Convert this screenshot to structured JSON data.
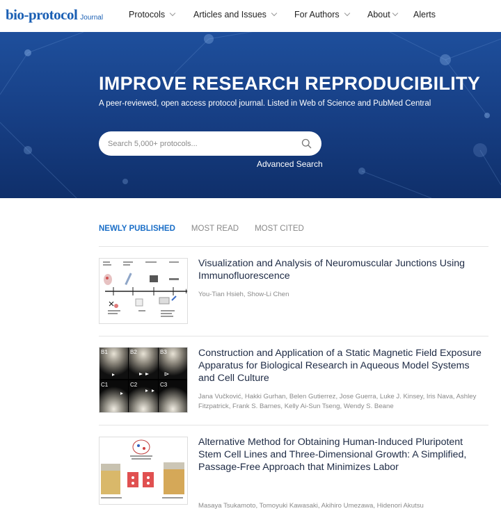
{
  "logo": {
    "main": "bio-protocol",
    "sub": "Journal"
  },
  "nav": [
    {
      "label": "Protocols",
      "dropdown": true
    },
    {
      "label": "Articles and Issues",
      "dropdown": true
    },
    {
      "label": "For Authors",
      "dropdown": true
    },
    {
      "label": "About",
      "dropdown": true
    },
    {
      "label": "Alerts",
      "dropdown": false
    }
  ],
  "hero": {
    "title": "IMPROVE RESEARCH REPRODUCIBILITY",
    "subtitle": "A peer-reviewed, open access protocol journal. Listed in Web of Science and PubMed Central",
    "search_placeholder": "Search 5,000+ protocols...",
    "advanced_search": "Advanced Search"
  },
  "tabs": [
    {
      "label": "NEWLY PUBLISHED",
      "active": true
    },
    {
      "label": "MOST READ",
      "active": false
    },
    {
      "label": "MOST CITED",
      "active": false
    }
  ],
  "articles": [
    {
      "title": "Visualization and Analysis of Neuromuscular Junctions Using Immunofluorescence",
      "authors": "You-Tian Hsieh, Show-Li Chen"
    },
    {
      "title": "Construction and Application of a Static Magnetic Field Exposure Apparatus for Biological Research in Aqueous Model Systems and Cell Culture",
      "authors": "Jana Vučković, Hakki Gurhan, Belen Gutierrez, Jose Guerra, Luke J. Kinsey, Iris Nava, Ashley Fitzpatrick, Frank S. Barnes, Kelly Ai-Sun Tseng, Wendy S. Beane",
      "thumb_labels": [
        "B1",
        "B2",
        "B3",
        "C1",
        "C2",
        "C3"
      ]
    },
    {
      "title": "Alternative Method for Obtaining Human-Induced Pluripotent Stem Cell Lines and Three-Dimensional Growth: A Simplified, Passage-Free Approach that Minimizes Labor",
      "authors": "Masaya Tsukamoto, Tomoyuki Kawasaki, Akihiro Umezawa, Hidenori Akutsu"
    }
  ],
  "colors": {
    "brand": "#1a5fb4",
    "hero": "#173f85",
    "active_tab": "#1a6ec7"
  }
}
